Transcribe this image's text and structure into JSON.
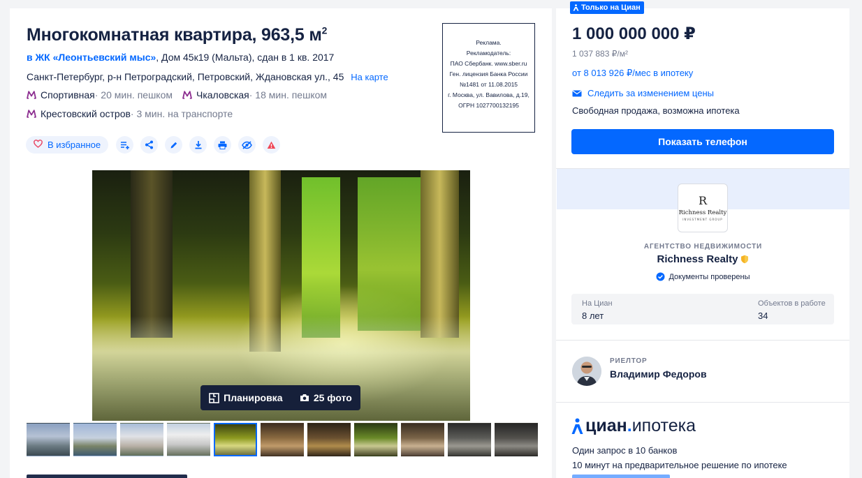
{
  "listing": {
    "title_main": "Многокомнатная квартира, 963,5 м",
    "title_sup": "2",
    "complex_link": "в ЖК «Леонтьевский мыс»",
    "complex_details": ", Дом 45к19 (Мальта), сдан в 1 кв. 2017",
    "address": "Санкт-Петербург, р-н Петроградский, Петровский, Ждановская ул., 45",
    "map_link": "На карте",
    "metro": [
      {
        "station": "Спортивная",
        "time": " · 20 мин. пешком"
      },
      {
        "station": "Чкаловская",
        "time": " · 18 мин. пешком"
      },
      {
        "station": "Крестовский остров",
        "time": " · 3 мин. на транспорте"
      }
    ],
    "metro_color": "#8b2c8f"
  },
  "ad": {
    "lines": [
      "Реклама.",
      "Рекламодатель:",
      "ПАО Сбербанк. www.sber.ru",
      "Ген. лицензия Банка России",
      "№1481 от 11.08.2015",
      "г. Москва, ул. Вавилова, д.19,",
      "ОГРН 1027700132195"
    ]
  },
  "actions": {
    "favorite_label": "В избранное",
    "icons": [
      "add-to-list-icon",
      "share-icon",
      "edit-icon",
      "download-icon",
      "print-icon",
      "hide-icon",
      "report-icon"
    ]
  },
  "gallery": {
    "plan_label": "Планировка",
    "photos_label": "25 фото",
    "thumb_count": 11,
    "active_thumb": 4
  },
  "sidebar": {
    "badge": "Только на Циан",
    "price": "1 000 000 000 ₽",
    "price_per_m2": "1 037 883 ₽/м²",
    "mortgage": "от 8 013 926 ₽/мес в ипотеку",
    "price_watch": "Следить за изменением цены",
    "sale_type": "Свободная продажа, возможна ипотека",
    "phone_button": "Показать телефон",
    "accent_color": "#0468ff"
  },
  "agency": {
    "logo_mono": "R",
    "logo_name": "Richness Realty",
    "logo_sub": "INVESTMENT GROUP",
    "kind": "АГЕНТСТВО НЕДВИЖИМОСТИ",
    "name": "Richness Realty",
    "docs": "Документы проверены",
    "stats": [
      {
        "label": "На Циан",
        "value": "8 лет"
      },
      {
        "label": "Объектов в работе",
        "value": "34"
      }
    ]
  },
  "realtor": {
    "role": "РИЕЛТОР",
    "name": "Владимир Федоров"
  },
  "ipoteka": {
    "brand": "циан",
    "dot": ".",
    "product": "ипотека",
    "line1": "Один запрос в 10 банков",
    "line2": "10 минут на предварительное решение по ипотеке"
  }
}
